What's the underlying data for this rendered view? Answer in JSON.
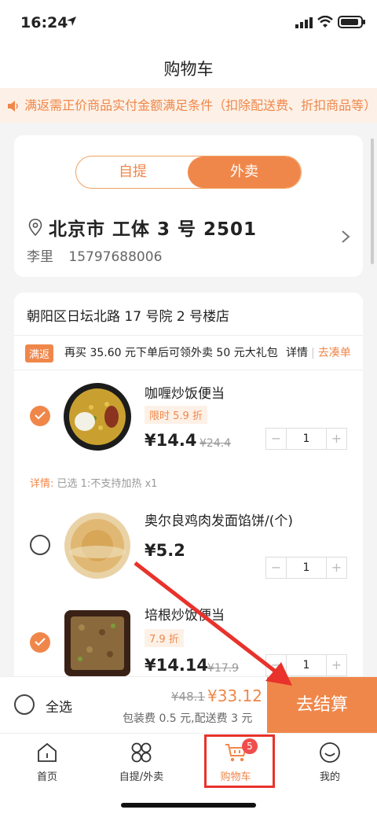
{
  "status": {
    "time": "16:24"
  },
  "header": {
    "title": "购物车"
  },
  "notice": {
    "text": "满返需正价商品实付金额满足条件（扣除配送费、折扣商品等）"
  },
  "mode_toggle": {
    "options": [
      "自提",
      "外卖"
    ],
    "selected": "外卖"
  },
  "address": {
    "main": "北京市  工体 3 号 2501",
    "name": "李里",
    "phone": "15797688006"
  },
  "store": {
    "name": "朝阳区日坛北路 17 号院 2 号楼店"
  },
  "promo": {
    "badge": "满返",
    "text": "再买 35.60 元下单后可领外卖 50 元大礼包",
    "detail": "详情",
    "link": "去凑单"
  },
  "items": [
    {
      "name": "咖喱炒饭便当",
      "tag": "限时 5.9 折",
      "price": "¥14.4",
      "original_price": "¥24.4",
      "qty": "1",
      "checked": true
    },
    {
      "name": "奥尔良鸡肉发面馅饼/(个)",
      "tag": "",
      "price": "¥5.2",
      "original_price": "",
      "qty": "1",
      "checked": false
    },
    {
      "name": "培根炒饭便当",
      "tag": "7.9 折",
      "price": "¥14.14",
      "original_price": "¥17.9",
      "qty": "1",
      "checked": true
    }
  ],
  "item_detail": {
    "label": "详情:",
    "text": "已选 1:不支持加热 x1"
  },
  "stepper": {
    "minus": "−",
    "plus": "+"
  },
  "checkout": {
    "select_all": "全选",
    "original_total": "¥48.1",
    "total": "¥33.12",
    "fees": "包装费 0.5 元,配送费 3 元",
    "pay_button": "去结算"
  },
  "tabbar": {
    "tabs": [
      {
        "label": "首页",
        "icon": "home-icon"
      },
      {
        "label": "自提/外卖",
        "icon": "grid-icon"
      },
      {
        "label": "购物车",
        "icon": "cart-icon",
        "badge": "5",
        "active": true
      },
      {
        "label": "我的",
        "icon": "profile-icon"
      }
    ]
  },
  "colors": {
    "accent": "#f0874a",
    "notice_bg": "#fdf1e7",
    "highlight_red": "#e8322b"
  }
}
